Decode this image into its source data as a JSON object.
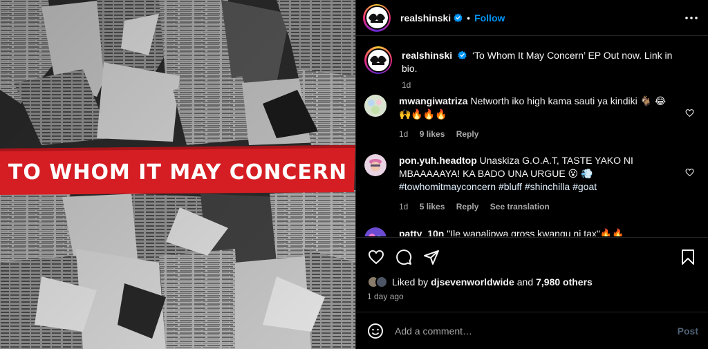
{
  "media": {
    "banner_text": "TO WHOM IT MAY CONCERN",
    "banner_color": "#d51e23"
  },
  "header": {
    "username": "realshinski",
    "separator": "•",
    "follow_label": "Follow",
    "avatar_text": "SHINSKI"
  },
  "caption": {
    "username": "realshinski",
    "text": "‘To Whom It May Concern’ EP Out now. Link in bio.",
    "time": "1d"
  },
  "comments": [
    {
      "username": "mwangiwatriza",
      "line1": "Networth iko high kama sauti ya kindiki 🐐 😂",
      "line2": "🙌🔥🔥🔥",
      "time": "1d",
      "likes": "9 likes",
      "reply": "Reply"
    },
    {
      "username": "pon.yuh.headtop",
      "text": "Unaskiza G.O.A.T, TASTE YAKO NI MBAAAAAYA! KA BADO UNA URGUE 😮 💨",
      "hashtags": "#towhomitmayconcern #bluff #shinchilla #goat",
      "time": "1d",
      "likes": "5 likes",
      "reply": "Reply",
      "translate": "See translation"
    },
    {
      "username": "patty_10n",
      "text": "\"Ile wanalipwa gross kwangu ni tax\"🔥🔥"
    }
  ],
  "likes": {
    "prefix": "Liked by",
    "user": "djsevenworldwide",
    "middle": "and",
    "others": "7,980 others"
  },
  "time_ago": "1 day ago",
  "composer": {
    "placeholder": "Add a comment…",
    "post_label": "Post"
  },
  "colors": {
    "link_blue": "#0095f6",
    "muted": "#a8a8a8",
    "verified_blue": "#0095f6"
  }
}
